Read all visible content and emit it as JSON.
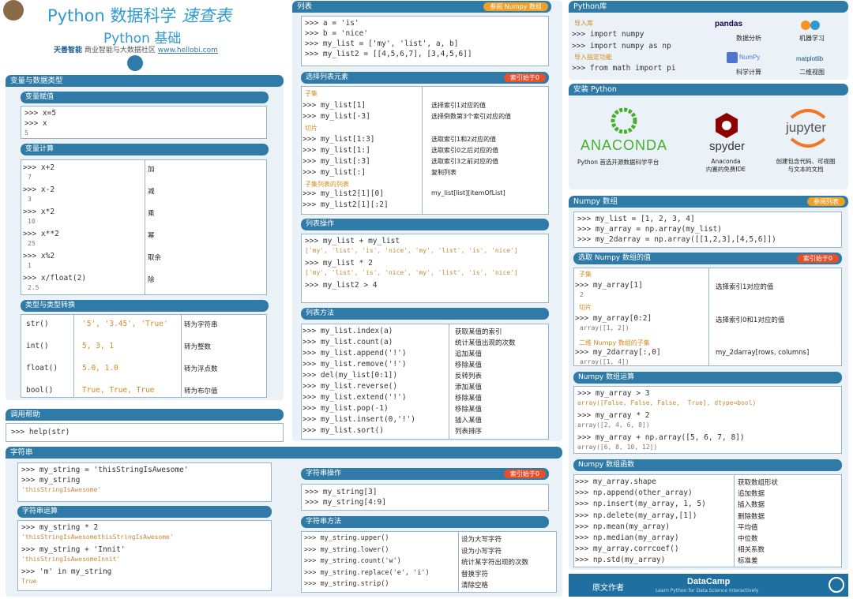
{
  "header": {
    "title_a": "Python 数据科学",
    "title_b": "速查表",
    "subtitle": "Python 基础",
    "credit_brand": "天善智能",
    "credit_text": "商业智能与大数据社区",
    "credit_url": "www.hellobi.com"
  },
  "basics": {
    "title": "变量与数据类型",
    "assign": {
      "title": "变量赋值",
      "lines": [
        ">>> x=5",
        ">>> x"
      ],
      "out": "5"
    },
    "calc": {
      "title": "变量计算",
      "rows": [
        {
          "code": ">>> x+2",
          "out": "7",
          "desc": "加"
        },
        {
          "code": ">>> x-2",
          "out": "3",
          "desc": "减"
        },
        {
          "code": ">>> x*2",
          "out": "10",
          "desc": "乘"
        },
        {
          "code": ">>> x**2",
          "out": "25",
          "desc": "幂"
        },
        {
          "code": ">>> x%2",
          "out": "1",
          "desc": "取余"
        },
        {
          "code": ">>> x/float(2)",
          "out": "2.5",
          "desc": "除"
        }
      ]
    },
    "types": {
      "title": "类型与类型转换",
      "rows": [
        {
          "fn": "str()",
          "val": "'5', '3.45', 'True'",
          "desc": "转为字符串"
        },
        {
          "fn": "int()",
          "val": "5, 3, 1",
          "desc": "转为整数"
        },
        {
          "fn": "float()",
          "val": "5.0, 1.0",
          "desc": "转为浮点数"
        },
        {
          "fn": "bool()",
          "val": "True, True, True",
          "desc": "转为布尔值"
        }
      ]
    }
  },
  "help": {
    "title": "调用帮助",
    "code": ">>> help(str)"
  },
  "lists": {
    "title": "列表",
    "tag": "参阅 Numpy 数组",
    "code": [
      ">>> a = 'is'",
      ">>> b = 'nice'",
      ">>> my_list = ['my', 'list', a, b]",
      ">>> my_list2 = [[4,5,6,7], [3,4,5,6]]"
    ],
    "select": {
      "title": "选择列表元素",
      "tag": "索引始于0",
      "sub1": "子集",
      "sub2": "切片",
      "sub3": "子集列表的列表",
      "rows": [
        {
          "code": ">>> my_list[1]",
          "desc": "选择索引1对应的值"
        },
        {
          "code": ">>> my_list[-3]",
          "desc": "选择倒数第3个索引对应的值"
        },
        {
          "code": ">>> my_list[1:3]",
          "desc": "选取索引1和2对应的值"
        },
        {
          "code": ">>> my_list[1:]",
          "desc": "选取索引0之后对应的值"
        },
        {
          "code": ">>> my_list[:3]",
          "desc": "选取索引3之前对应的值"
        },
        {
          "code": ">>> my_list[:]",
          "desc": "复制列表"
        },
        {
          "code": ">>> my_list2[1][0]",
          "desc": "my_list[list][itemOfList]"
        },
        {
          "code": ">>> my_list2[1][:2]",
          "desc": ""
        }
      ]
    },
    "ops": {
      "title": "列表操作",
      "lines": [
        ">>> my_list + my_list",
        ">>> my_list * 2",
        ">>> my_list2 > 4"
      ],
      "outs": [
        "['my', 'list', 'is', 'nice', 'my', 'list', 'is', 'nice']",
        "['my', 'list', 'is', 'nice', 'my', 'list', 'is', 'nice']"
      ]
    },
    "methods": {
      "title": "列表方法",
      "rows": [
        {
          "code": ">>> my_list.index(a)",
          "desc": "获取某值的索引"
        },
        {
          "code": ">>> my_list.count(a)",
          "desc": "统计某值出现的次数"
        },
        {
          "code": ">>> my_list.append('!')",
          "desc": "追加某值"
        },
        {
          "code": ">>> my_list.remove('!')",
          "desc": "移除某值"
        },
        {
          "code": ">>> del(my_list[0:1])",
          "desc": "反转列表"
        },
        {
          "code": ">>> my_list.reverse()",
          "desc": "添加某值"
        },
        {
          "code": ">>> my_list.extend('!')",
          "desc": "移除某值"
        },
        {
          "code": ">>> my_list.pop(-1)",
          "desc": "移除某值"
        },
        {
          "code": ">>> my_list.insert(0,'!')",
          "desc": "插入某值"
        },
        {
          "code": ">>> my_list.sort()",
          "desc": "列表排序"
        }
      ]
    }
  },
  "strings": {
    "title": "字符串",
    "intro": {
      "lines": [
        ">>> my_string = 'thisStringIsAwesome'",
        ">>> my_string"
      ],
      "out": "'thisStringIsAwesome'"
    },
    "ops": {
      "title": "字符串运算",
      "rows": [
        {
          "code": ">>> my_string * 2",
          "out": "'thisStringIsAwesomethisStringIsAwesome'"
        },
        {
          "code": ">>> my_string + 'Innit'",
          "out": "'thisStringIsAwesomeInnit'"
        },
        {
          "code": ">>> 'm' in my_string",
          "out": "True"
        }
      ]
    },
    "slice": {
      "title": "字符串操作",
      "tag": "索引始于0",
      "lines": [
        ">>> my_string[3]",
        ">>> my_string[4:9]"
      ]
    },
    "methods": {
      "title": "字符串方法",
      "rows": [
        {
          "code": ">>> my_string.upper()",
          "desc": "设为大写字符"
        },
        {
          "code": ">>> my_string.lower()",
          "desc": "设为小写字符"
        },
        {
          "code": ">>> my_string.count('w')",
          "desc": "统计某字符出现的次数"
        },
        {
          "code": ">>> my_string.replace('e', 'i')",
          "desc": "替换字符"
        },
        {
          "code": ">>> my_string.strip()",
          "desc": "清除空格"
        }
      ]
    }
  },
  "libs": {
    "title": "Python库",
    "import_label": "导入库",
    "partial_label": "导入指定功能",
    "lines": [
      ">>> import numpy",
      ">>> import numpy as np",
      ">>> from math import pi"
    ],
    "items": [
      {
        "name": "pandas",
        "desc": "数据分析"
      },
      {
        "name": "",
        "desc": "机器学习"
      },
      {
        "name": "NumPy",
        "desc": "科学计算"
      },
      {
        "name": "matplotlib",
        "desc": "二维视图"
      }
    ]
  },
  "install": {
    "title": "安装 Python",
    "items": [
      {
        "name": "ANACONDA",
        "desc": "Python 首选开源数据科学平台"
      },
      {
        "name": "spyder",
        "desc": "Anaconda\n内置的免费IDE"
      },
      {
        "name": "jupyter",
        "desc": "创建包含代码、可视图\n与文本的文档"
      }
    ]
  },
  "numpy": {
    "title": "Numpy 数组",
    "tag": "参阅列表",
    "code": [
      ">>> my_list = [1, 2, 3, 4]",
      ">>> my_array = np.array(my_list)",
      ">>> my_2darray = np.array([[1,2,3],[4,5,6]])"
    ],
    "select": {
      "title": "选取 Numpy 数组的值",
      "tag": "索引始于0",
      "sub1": "子集",
      "sub2": "切片",
      "sub3": "二维 Numpy 数组的子集",
      "rows": [
        {
          "code": ">>> my_array[1]",
          "out": "2",
          "desc": "选择索引1对应的值"
        },
        {
          "code": ">>> my_array[0:2]",
          "out": "array([1, 2])",
          "desc": "选择索引0和1对应的值"
        },
        {
          "code": ">>> my_2darray[:,0]",
          "out": "array([1, 4])",
          "desc": "my_2darray[rows, columns]"
        }
      ]
    },
    "ops": {
      "title": "Numpy 数组运算",
      "rows": [
        {
          "code": ">>> my_array > 3",
          "out": "array([False, False, False,  True], dtype=bool)"
        },
        {
          "code": ">>> my_array * 2",
          "out": "array([2, 4, 6, 8])"
        },
        {
          "code": ">>> my_array + np.array([5, 6, 7, 8])",
          "out": "array([6, 8, 10, 12])"
        }
      ]
    },
    "funcs": {
      "title": "Numpy 数组函数",
      "rows": [
        {
          "code": ">>> my_array.shape",
          "desc": "获取数组形状"
        },
        {
          "code": ">>> np.append(other_array)",
          "desc": "追加数据"
        },
        {
          "code": ">>> np.insert(my_array, 1, 5)",
          "desc": "插入数据"
        },
        {
          "code": ">>> np.delete(my_array,[1])",
          "desc": "删除数据"
        },
        {
          "code": ">>> np.mean(my_array)",
          "desc": "平均值"
        },
        {
          "code": ">>> np.median(my_array)",
          "desc": "中位数"
        },
        {
          "code": ">>> my_array.corrcoef()",
          "desc": "相关系数"
        },
        {
          "code": ">>> np.std(my_array)",
          "desc": "标准差"
        }
      ]
    }
  },
  "footer": {
    "left": "原文作者",
    "brand": "DataCamp",
    "tagline": "Learn Python for Data Science Interactively"
  }
}
